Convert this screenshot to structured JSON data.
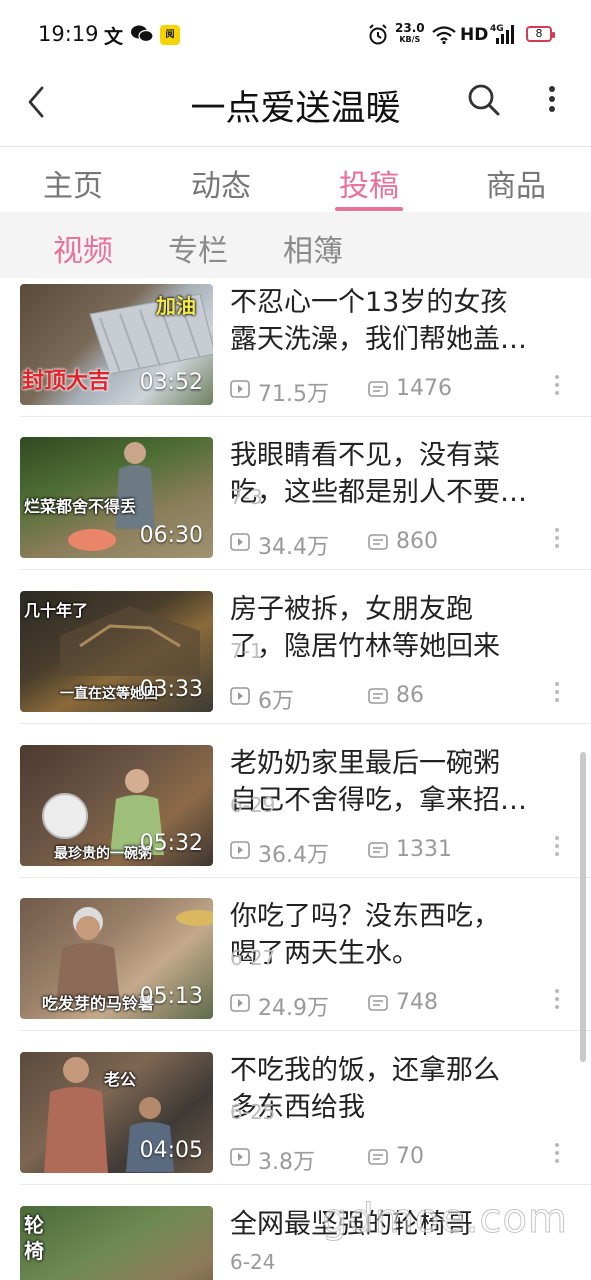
{
  "status_bar": {
    "time": "19:19",
    "wen": "文",
    "app_badge": "阅",
    "speed_value": "23.0",
    "speed_unit": "KB/S",
    "hd": "HD",
    "net": "4G",
    "battery": "8"
  },
  "header": {
    "title": "一点爱送温暖"
  },
  "tabs": [
    "主页",
    "动态",
    "投稿",
    "商品"
  ],
  "active_tab": "投稿",
  "subtabs": [
    "视频",
    "专栏",
    "相簿"
  ],
  "active_subtab": "视频",
  "videos": [
    {
      "title_l1": "不忍心一个13岁的女孩",
      "title_l2": "露天洗澡，我们帮她盖…",
      "date": "",
      "duration": "03:52",
      "views": "71.5万",
      "comments": "1476",
      "caption": "封顶大吉",
      "caption2": "加油"
    },
    {
      "title_l1": "我眼睛看不见，没有菜",
      "title_l2": "吃，这些都是别人不要…",
      "date": "7-3",
      "duration": "06:30",
      "views": "34.4万",
      "comments": "860",
      "caption": "烂菜都舍不得丢",
      "caption2": ""
    },
    {
      "title_l1": "房子被拆，女朋友跑",
      "title_l2": "了，隐居竹林等她回来",
      "date": "7-1",
      "duration": "03:33",
      "views": "6万",
      "comments": "86",
      "caption": "一直在这等她回",
      "caption2": "几十年了"
    },
    {
      "title_l1": "老奶奶家里最后一碗粥",
      "title_l2": "自己不舍得吃，拿来招…",
      "date": "6-29",
      "duration": "05:32",
      "views": "36.4万",
      "comments": "1331",
      "caption": "最珍贵的一碗粥",
      "caption2": ""
    },
    {
      "title_l1": "你吃了吗？没东西吃，",
      "title_l2": "喝了两天生水。",
      "date": "6-27",
      "duration": "05:13",
      "views": "24.9万",
      "comments": "748",
      "caption": "吃发芽的马铃薯",
      "caption2": ""
    },
    {
      "title_l1": "不吃我的饭，还拿那么",
      "title_l2": "多东西给我",
      "date": "6-25",
      "duration": "04:05",
      "views": "3.8万",
      "comments": "70",
      "caption": "老公",
      "caption2": ""
    },
    {
      "title_l1": "全网最坚强的轮椅哥",
      "title_l2": "",
      "date": "6-24",
      "duration": "",
      "views": "",
      "comments": "",
      "caption": "轮椅",
      "caption2": ""
    }
  ],
  "watermark": "gdmoe.com",
  "colors": {
    "accent": "#e9719a",
    "text": "#222222",
    "muted": "#9a9a9a"
  },
  "icons": [
    "back-arrow-icon",
    "search-icon",
    "more-vertical-icon",
    "play-icon",
    "comment-icon"
  ]
}
